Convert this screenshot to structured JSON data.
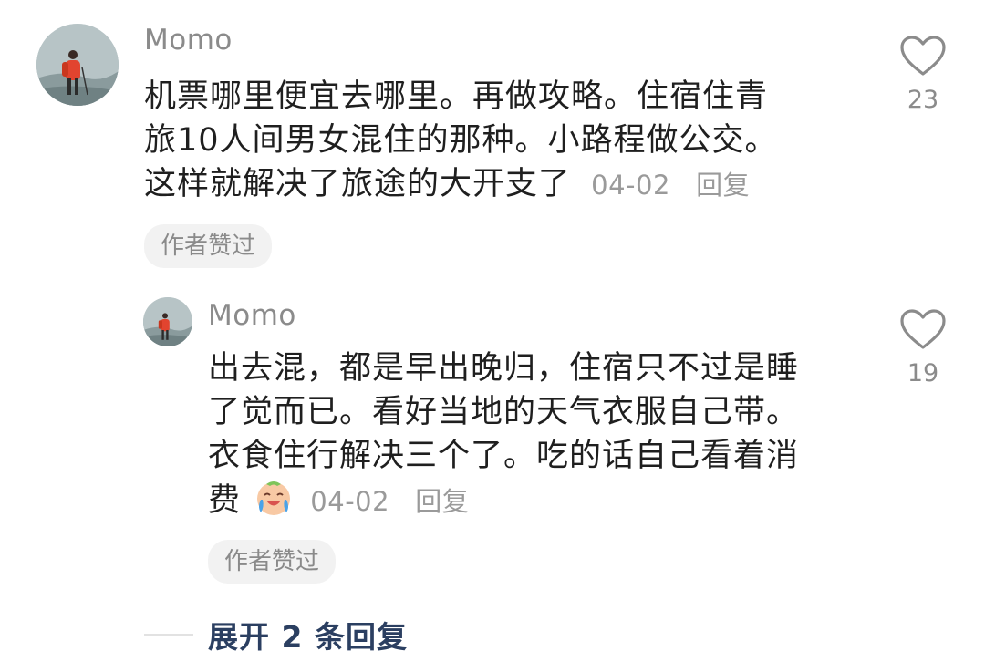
{
  "comments": [
    {
      "username": "Momo",
      "text_lines": [
        "机票哪里便宜去哪里。再做攻略。住宿住青",
        "旅10人间男女混住的那种。小路程做公交。",
        "这样就解决了旅途的大开支了"
      ],
      "date": "04-02",
      "reply_label": "回复",
      "badge": "作者赞过",
      "likes": "23",
      "like_icon": "heart-outline-icon"
    }
  ],
  "replies": [
    {
      "username": "Momo",
      "text_lines": [
        "出去混，都是早出晚归，住宿只不过是睡",
        "了觉而已。看好当地的天气衣服自己带。",
        "衣食住行解决三个了。吃的话自己看着消",
        "费"
      ],
      "emoji": "crying-laughing-emoji",
      "date": "04-02",
      "reply_label": "回复",
      "badge": "作者赞过",
      "likes": "19",
      "like_icon": "heart-outline-icon"
    }
  ],
  "expand_label": "展开 2 条回复",
  "colors": {
    "link": "#2b3f61",
    "muted": "#9a9a9a",
    "text": "#1f1f1f",
    "badge_bg": "#f2f2f2"
  }
}
